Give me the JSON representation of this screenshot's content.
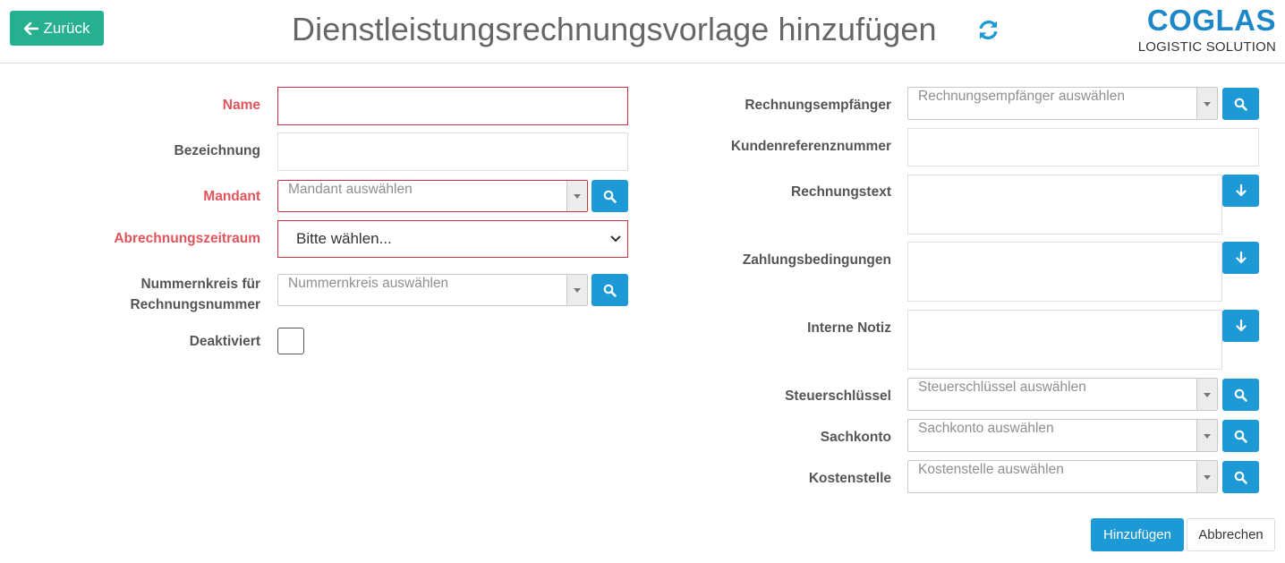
{
  "header": {
    "back_label": "Zurück",
    "title": "Dienstleistungsrechnungsvorlage hinzufügen",
    "logo_main": "COGLAS",
    "logo_sub": "LOGISTIC SOLUTION"
  },
  "left": {
    "name_label": "Name",
    "name_value": "",
    "bezeichnung_label": "Bezeichnung",
    "bezeichnung_value": "",
    "mandant_label": "Mandant",
    "mandant_placeholder": "Mandant auswählen",
    "abrechnungszeitraum_label": "Abrechnungszeitraum",
    "abrechnungszeitraum_value": "Bitte wählen...",
    "nummernkreis_label_line1": "Nummernkreis für",
    "nummernkreis_label_line2": "Rechnungsnummer",
    "nummernkreis_placeholder": "Nummernkreis auswählen",
    "deaktiviert_label": "Deaktiviert",
    "deaktiviert_checked": false
  },
  "right": {
    "rechnungsempfaenger_label": "Rechnungsempfänger",
    "rechnungsempfaenger_placeholder": "Rechnungsempfänger auswählen",
    "kundenreferenz_label": "Kundenreferenznummer",
    "kundenreferenz_value": "",
    "rechnungstext_label": "Rechnungstext",
    "zahlungsbedingungen_label": "Zahlungsbedingungen",
    "interne_notiz_label": "Interne Notiz",
    "steuerschluessel_label": "Steuerschlüssel",
    "steuerschluessel_placeholder": "Steuerschlüssel auswählen",
    "sachkonto_label": "Sachkonto",
    "sachkonto_placeholder": "Sachkonto auswählen",
    "kostenstelle_label": "Kostenstelle",
    "kostenstelle_placeholder": "Kostenstelle auswählen"
  },
  "footer": {
    "submit_label": "Hinzufügen",
    "cancel_label": "Abbrechen"
  },
  "colors": {
    "primary": "#1d9ad6",
    "back_button": "#26b08f",
    "required": "#e2545b",
    "logo": "#1e87c8"
  },
  "icons": {
    "back": "arrow-left-icon",
    "refresh": "refresh-icon",
    "search": "search-icon",
    "template_insert": "arrow-down-icon",
    "dropdown": "caret-down-icon"
  }
}
